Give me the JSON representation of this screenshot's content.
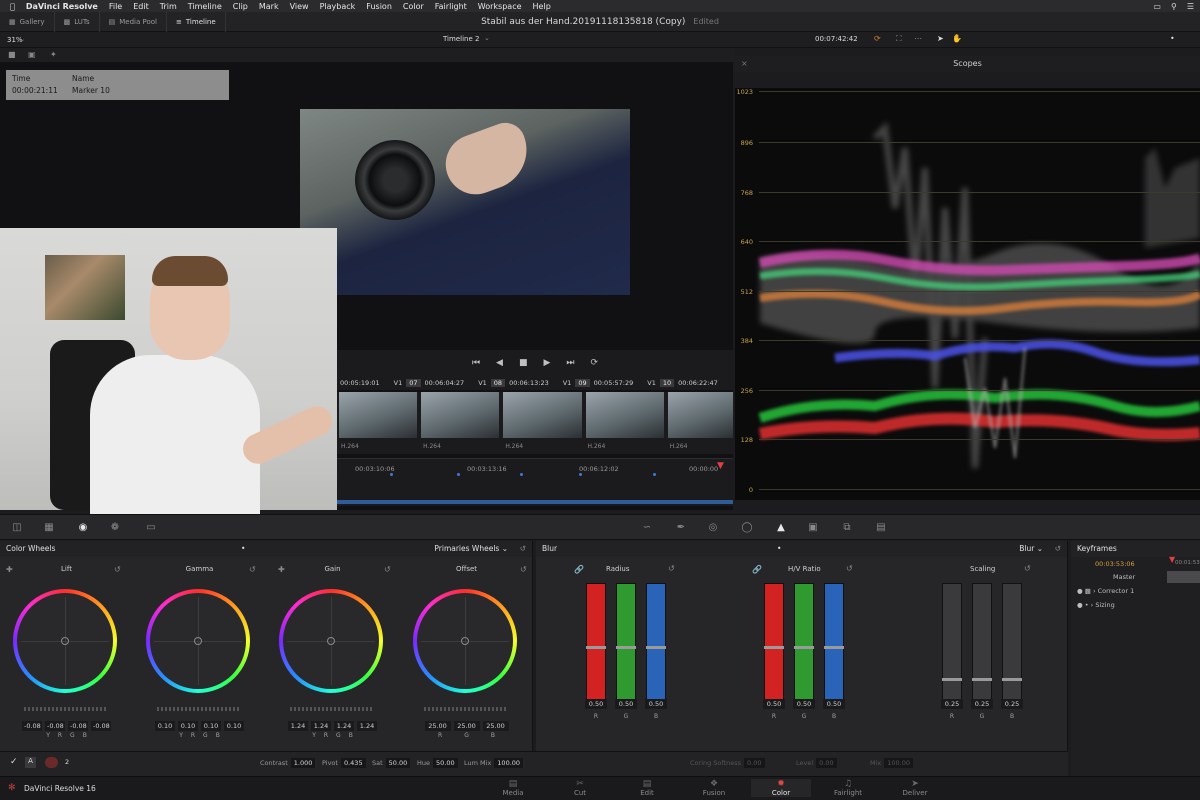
{
  "menubar": {
    "app": "DaVinci Resolve",
    "items": [
      "File",
      "Edit",
      "Trim",
      "Timeline",
      "Clip",
      "Mark",
      "View",
      "Playback",
      "Fusion",
      "Color",
      "Fairlight",
      "Workspace",
      "Help"
    ]
  },
  "topbar": {
    "gallery": "Gallery",
    "luts": "LUTs",
    "media_pool": "Media Pool",
    "timeline": "Timeline",
    "project_title": "Stabil aus der Hand.20191118135818 (Copy)",
    "edited": "Edited"
  },
  "viewer": {
    "zoom": "31%",
    "timeline_name": "Timeline 2",
    "timecode": "00:07:42:42",
    "marker": {
      "time_label": "Time",
      "name_label": "Name",
      "time": "00:00:21:11",
      "name": "Marker 10"
    }
  },
  "clips": {
    "items": [
      {
        "tc": "00:05:19:01",
        "track": "V1",
        "num": "07"
      },
      {
        "tc": "00:06:04:27",
        "track": "V1",
        "num": "08"
      },
      {
        "tc": "00:06:13:23",
        "track": "V1",
        "num": "09"
      },
      {
        "tc": "00:05:57:29",
        "track": "V1",
        "num": "10"
      },
      {
        "tc": "00:06:22:47",
        "track": "",
        "num": ""
      }
    ],
    "codec": "H.264",
    "mini_timecodes": [
      "00:03:10:06",
      "00:03:13:16",
      "00:06:12:02",
      "00:00:00"
    ]
  },
  "scopes": {
    "title": "Scopes",
    "scale": [
      "1023",
      "896",
      "768",
      "640",
      "512",
      "384",
      "256",
      "128",
      "0"
    ]
  },
  "color_wheels": {
    "title": "Color Wheels",
    "mode": "Primaries Wheels",
    "wheels": [
      {
        "label": "Lift",
        "values": [
          "-0.08",
          "-0.08",
          "-0.08",
          "-0.08"
        ]
      },
      {
        "label": "Gamma",
        "values": [
          "0.10",
          "0.10",
          "0.10",
          "0.10"
        ]
      },
      {
        "label": "Gain",
        "values": [
          "1.24",
          "1.24",
          "1.24",
          "1.24"
        ]
      },
      {
        "label": "Offset",
        "values": [
          "25.00",
          "25.00",
          "25.00",
          "25.00"
        ]
      }
    ],
    "channels": [
      "Y",
      "R",
      "G",
      "B"
    ]
  },
  "blur": {
    "title": "Blur",
    "mode": "Blur",
    "groups": [
      {
        "label": "Radius",
        "values": [
          "0.50",
          "0.50",
          "0.50"
        ],
        "level": 0.5
      },
      {
        "label": "H/V Ratio",
        "values": [
          "0.50",
          "0.50",
          "0.50"
        ],
        "level": 0.5
      },
      {
        "label": "Scaling",
        "values": [
          "0.25",
          "0.25",
          "0.25"
        ],
        "level": 0.25
      }
    ],
    "channels": [
      "R",
      "G",
      "B"
    ],
    "colors": {
      "r": "#d32222",
      "g": "#2f9a2f",
      "b": "#2a64b8"
    }
  },
  "adjust": {
    "node_num": "2",
    "contrast_label": "Contrast",
    "contrast": "1.000",
    "pivot_label": "Pivot",
    "pivot": "0.435",
    "sat_label": "Sat",
    "sat": "50.00",
    "hue_label": "Hue",
    "hue": "50.00",
    "lummix_label": "Lum Mix",
    "lummix": "100.00",
    "coring_label": "Coring Softness",
    "coring": "0.00",
    "level_label": "Level",
    "level": "0.00",
    "mix_label": "Mix",
    "mix": "100.00"
  },
  "keyframes": {
    "title": "Keyframes",
    "tc": "00:03:53:06",
    "tc2": "00:01:53",
    "rows": [
      "Master",
      "Corrector 1",
      "Sizing"
    ]
  },
  "pages": {
    "brand": "DaVinci Resolve 16",
    "items": [
      "Media",
      "Cut",
      "Edit",
      "Fusion",
      "Color",
      "Fairlight",
      "Deliver"
    ],
    "active": "Color"
  }
}
